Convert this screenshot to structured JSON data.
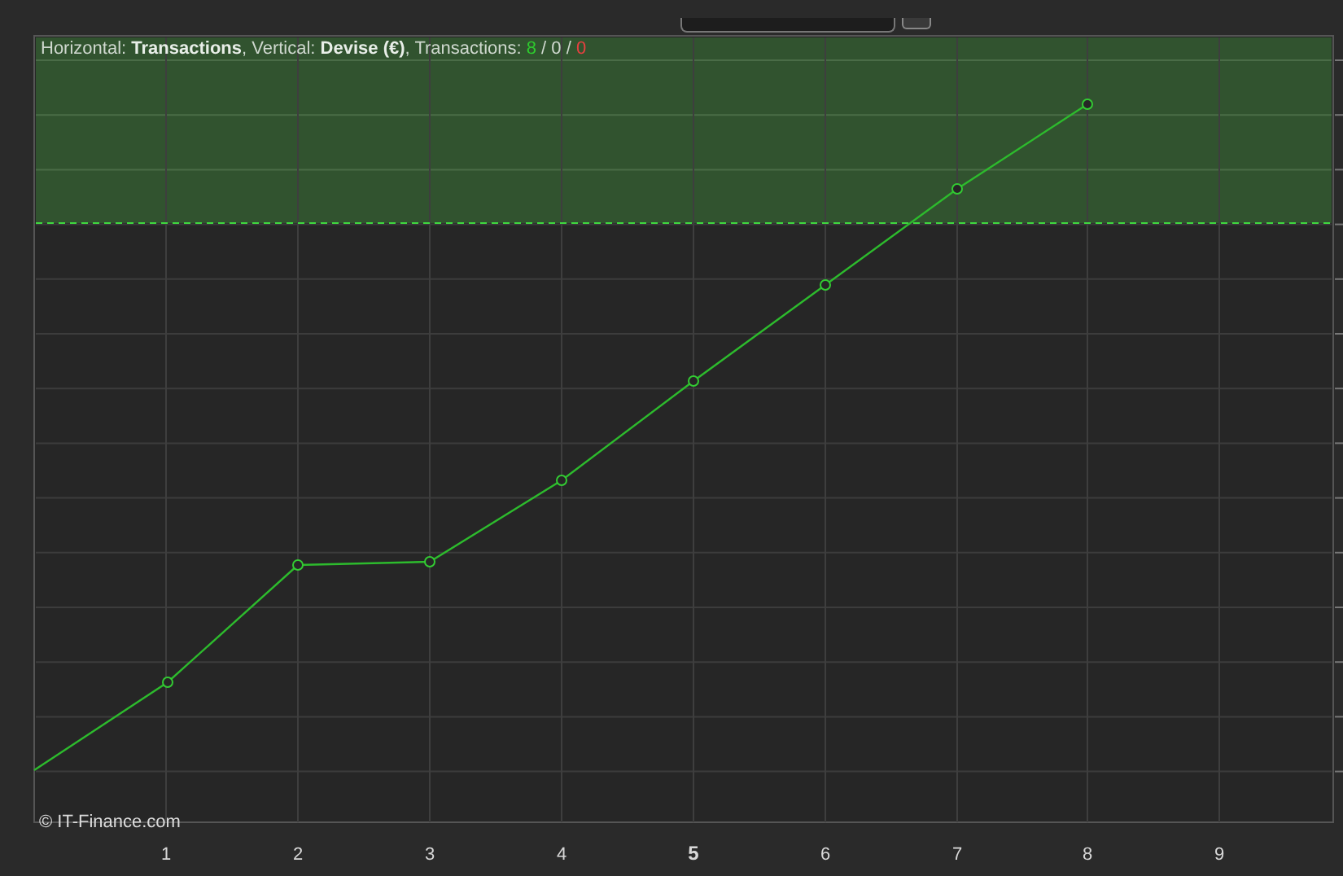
{
  "legend": [
    {
      "text": "Horizontal: ",
      "kind": "plain"
    },
    {
      "text": "Transactions",
      "kind": "value"
    },
    {
      "text": ", Vertical: ",
      "kind": "plain"
    },
    {
      "text": "Devise (€)",
      "kind": "value"
    },
    {
      "text": ", Transactions: ",
      "kind": "plain"
    },
    {
      "text": "8",
      "kind": "win"
    },
    {
      "text": " / 0 / ",
      "kind": "plain"
    },
    {
      "text": "0",
      "kind": "loss"
    }
  ],
  "copyright": "© IT-Finance.com",
  "x_axis_labels": [
    {
      "label": "1",
      "emphasized": false
    },
    {
      "label": "2",
      "emphasized": false
    },
    {
      "label": "3",
      "emphasized": false
    },
    {
      "label": "4",
      "emphasized": false
    },
    {
      "label": "5",
      "emphasized": true
    },
    {
      "label": "6",
      "emphasized": false
    },
    {
      "label": "7",
      "emphasized": false
    },
    {
      "label": "8",
      "emphasized": false
    },
    {
      "label": "9",
      "emphasized": false
    }
  ]
}
